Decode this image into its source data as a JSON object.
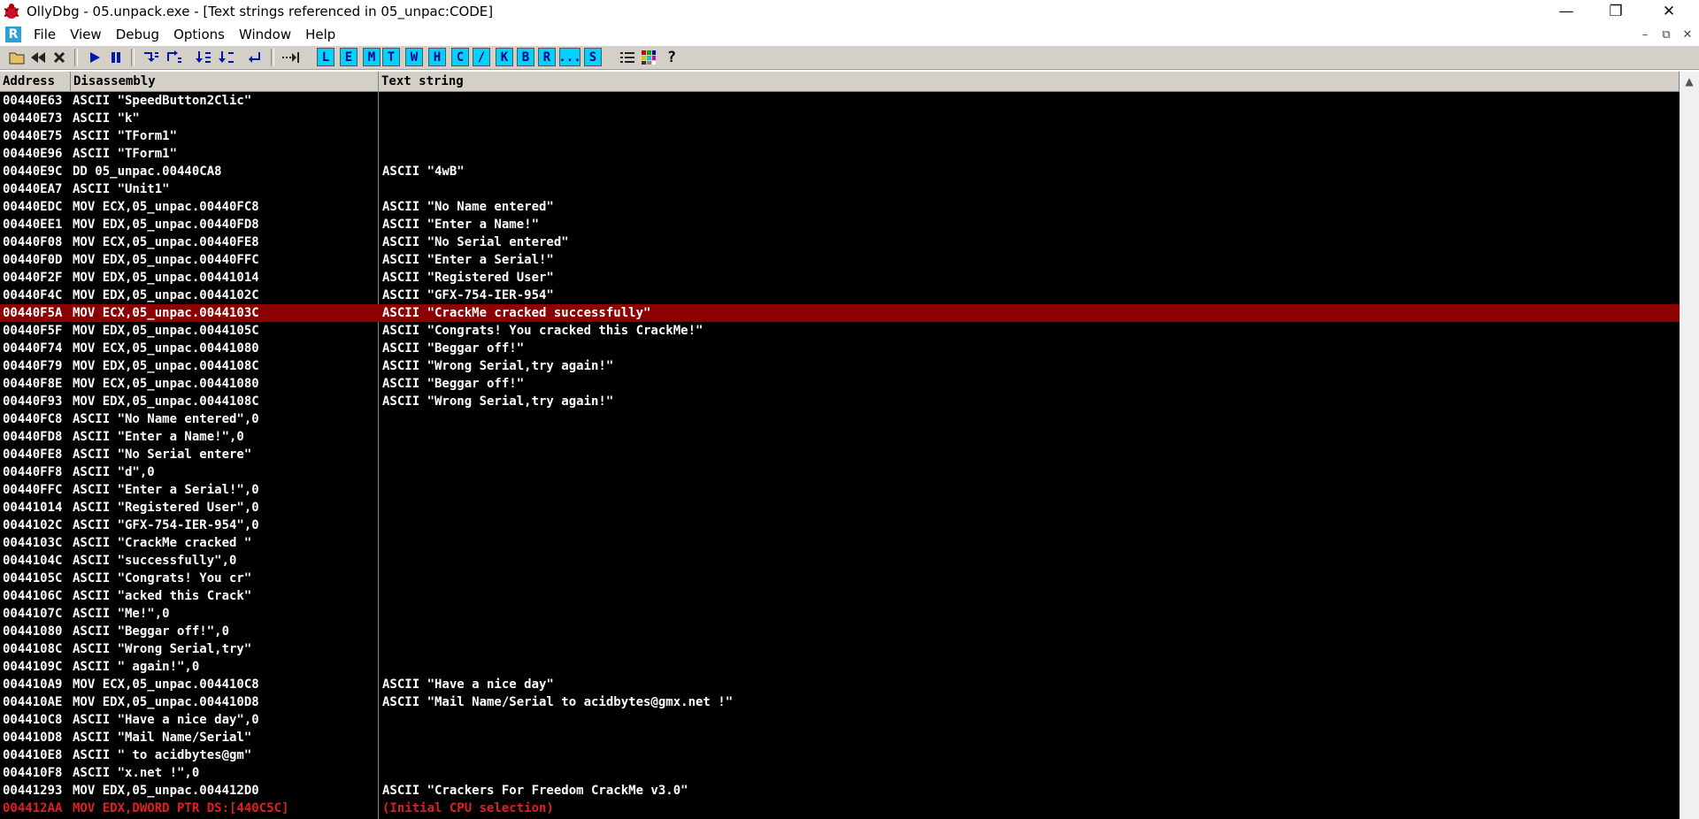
{
  "window": {
    "title": "OllyDbg - 05.unpack.exe - [Text strings referenced in 05_unpac:CODE]",
    "app_icon": "bug-icon",
    "controls": {
      "minimize": "—",
      "restore": "❐",
      "close": "✕"
    }
  },
  "menubar": {
    "badge": "R",
    "items": [
      "File",
      "View",
      "Debug",
      "Options",
      "Window",
      "Help"
    ],
    "mdi": {
      "minimize": "–",
      "restore": "⧉",
      "close": "✕"
    }
  },
  "toolbar": {
    "icons": [
      "open-icon",
      "rewind-icon",
      "close-file-icon",
      "run-icon",
      "pause-icon",
      "step-into-icon",
      "step-over-icon",
      "trace-into-icon",
      "trace-over-icon",
      "execute-till-return-icon",
      "goto-icon"
    ],
    "letters": [
      "L",
      "E",
      "M",
      "T",
      "W",
      "H",
      "C",
      "/",
      "K",
      "B",
      "R",
      "...",
      "S"
    ],
    "right_icons": [
      "list-icon",
      "palette-icon",
      "help-icon"
    ]
  },
  "columns": [
    "Address",
    "Disassembly",
    "Text string"
  ],
  "rows": [
    {
      "addr": "00440E63",
      "dis": "ASCII \"SpeedButton2Clic\"",
      "text": ""
    },
    {
      "addr": "00440E73",
      "dis": "ASCII \"k\"",
      "text": ""
    },
    {
      "addr": "00440E75",
      "dis": "ASCII \"TForm1\"",
      "text": ""
    },
    {
      "addr": "00440E96",
      "dis": "ASCII \"TForm1\"",
      "text": ""
    },
    {
      "addr": "00440E9C",
      "dis": "DD 05_unpac.00440CA8",
      "text": "ASCII \"4wB\""
    },
    {
      "addr": "00440EA7",
      "dis": "ASCII \"Unit1\"",
      "text": ""
    },
    {
      "addr": "00440EDC",
      "dis": "MOV ECX,05_unpac.00440FC8",
      "text": "ASCII \"No Name entered\""
    },
    {
      "addr": "00440EE1",
      "dis": "MOV EDX,05_unpac.00440FD8",
      "text": "ASCII \"Enter a Name!\""
    },
    {
      "addr": "00440F08",
      "dis": "MOV ECX,05_unpac.00440FE8",
      "text": "ASCII \"No Serial entered\""
    },
    {
      "addr": "00440F0D",
      "dis": "MOV EDX,05_unpac.00440FFC",
      "text": "ASCII \"Enter a Serial!\""
    },
    {
      "addr": "00440F2F",
      "dis": "MOV EDX,05_unpac.00441014",
      "text": "ASCII \"Registered User\""
    },
    {
      "addr": "00440F4C",
      "dis": "MOV EDX,05_unpac.0044102C",
      "text": "ASCII \"GFX-754-IER-954\""
    },
    {
      "addr": "00440F5A",
      "dis": "MOV ECX,05_unpac.0044103C",
      "text": "ASCII \"CrackMe cracked successfully\"",
      "selected": true
    },
    {
      "addr": "00440F5F",
      "dis": "MOV EDX,05_unpac.0044105C",
      "text": "ASCII \"Congrats! You cracked this CrackMe!\""
    },
    {
      "addr": "00440F74",
      "dis": "MOV ECX,05_unpac.00441080",
      "text": "ASCII \"Beggar off!\""
    },
    {
      "addr": "00440F79",
      "dis": "MOV EDX,05_unpac.0044108C",
      "text": "ASCII \"Wrong Serial,try again!\""
    },
    {
      "addr": "00440F8E",
      "dis": "MOV ECX,05_unpac.00441080",
      "text": "ASCII \"Beggar off!\""
    },
    {
      "addr": "00440F93",
      "dis": "MOV EDX,05_unpac.0044108C",
      "text": "ASCII \"Wrong Serial,try again!\""
    },
    {
      "addr": "00440FC8",
      "dis": "ASCII \"No Name entered\",0",
      "text": ""
    },
    {
      "addr": "00440FD8",
      "dis": "ASCII \"Enter a Name!\",0",
      "text": ""
    },
    {
      "addr": "00440FE8",
      "dis": "ASCII \"No Serial entere\"",
      "text": ""
    },
    {
      "addr": "00440FF8",
      "dis": "ASCII \"d\",0",
      "text": ""
    },
    {
      "addr": "00440FFC",
      "dis": "ASCII \"Enter a Serial!\",0",
      "text": ""
    },
    {
      "addr": "00441014",
      "dis": "ASCII \"Registered User\",0",
      "text": ""
    },
    {
      "addr": "0044102C",
      "dis": "ASCII \"GFX-754-IER-954\",0",
      "text": ""
    },
    {
      "addr": "0044103C",
      "dis": "ASCII \"CrackMe cracked \"",
      "text": ""
    },
    {
      "addr": "0044104C",
      "dis": "ASCII \"successfully\",0",
      "text": ""
    },
    {
      "addr": "0044105C",
      "dis": "ASCII \"Congrats! You cr\"",
      "text": ""
    },
    {
      "addr": "0044106C",
      "dis": "ASCII \"acked this Crack\"",
      "text": ""
    },
    {
      "addr": "0044107C",
      "dis": "ASCII \"Me!\",0",
      "text": ""
    },
    {
      "addr": "00441080",
      "dis": "ASCII \"Beggar off!\",0",
      "text": ""
    },
    {
      "addr": "0044108C",
      "dis": "ASCII \"Wrong Serial,try\"",
      "text": ""
    },
    {
      "addr": "0044109C",
      "dis": "ASCII \" again!\",0",
      "text": ""
    },
    {
      "addr": "004410A9",
      "dis": "MOV ECX,05_unpac.004410C8",
      "text": "ASCII \"Have a nice day\""
    },
    {
      "addr": "004410AE",
      "dis": "MOV EDX,05_unpac.004410D8",
      "text": "ASCII \"Mail Name/Serial to acidbytes@gmx.net !\""
    },
    {
      "addr": "004410C8",
      "dis": "ASCII \"Have a nice day\",0",
      "text": ""
    },
    {
      "addr": "004410D8",
      "dis": "ASCII \"Mail Name/Serial\"",
      "text": ""
    },
    {
      "addr": "004410E8",
      "dis": "ASCII \" to acidbytes@gm\"",
      "text": ""
    },
    {
      "addr": "004410F8",
      "dis": "ASCII \"x.net !\",0",
      "text": ""
    },
    {
      "addr": "00441293",
      "dis": "MOV EDX,05_unpac.004412D0",
      "text": "ASCII \"Crackers For Freedom CrackMe v3.0\""
    },
    {
      "addr": "004412AA",
      "dis": "MOV EDX,DWORD PTR DS:[440C5C]",
      "text": "(Initial CPU selection)",
      "red": true
    }
  ],
  "colors": {
    "background": "#000000",
    "text": "#ffffff",
    "selection": "#8b0000",
    "initial_cpu": "#e02020",
    "toolbar_letters": "#00d2ff"
  }
}
